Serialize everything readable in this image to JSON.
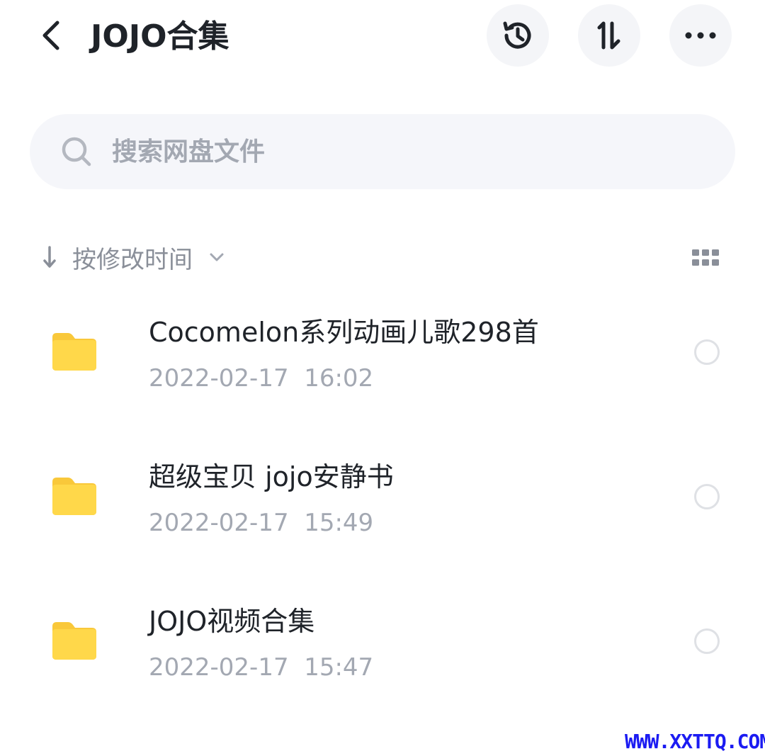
{
  "header": {
    "title": "JOJO合集",
    "back_icon": "chevron-left-icon",
    "history_icon": "history-icon",
    "sort_icon": "sort-arrows-icon",
    "more_icon": "more-horizontal-icon"
  },
  "search": {
    "placeholder": "搜索网盘文件",
    "icon": "search-icon"
  },
  "sort_bar": {
    "label": "按修改时间",
    "direction_icon": "arrow-down-icon",
    "dropdown_icon": "chevron-down-icon",
    "view_icon": "grid-view-icon"
  },
  "files": [
    {
      "name": "Cocomelon系列动画儿歌298首",
      "date": "2022-02-17  16:02",
      "type": "folder"
    },
    {
      "name": "超级宝贝 jojo安静书",
      "date": "2022-02-17  15:49",
      "type": "folder"
    },
    {
      "name": "JOJO视频合集",
      "date": "2022-02-17  15:47",
      "type": "folder"
    }
  ],
  "colors": {
    "folder": "#ffd84a",
    "folder_tab": "#f9c83a",
    "text_primary": "#1f2329",
    "text_secondary": "#a3a8b2",
    "watermark": "#1b1bf2"
  },
  "watermark": "WWW.XXTTQ.COM"
}
